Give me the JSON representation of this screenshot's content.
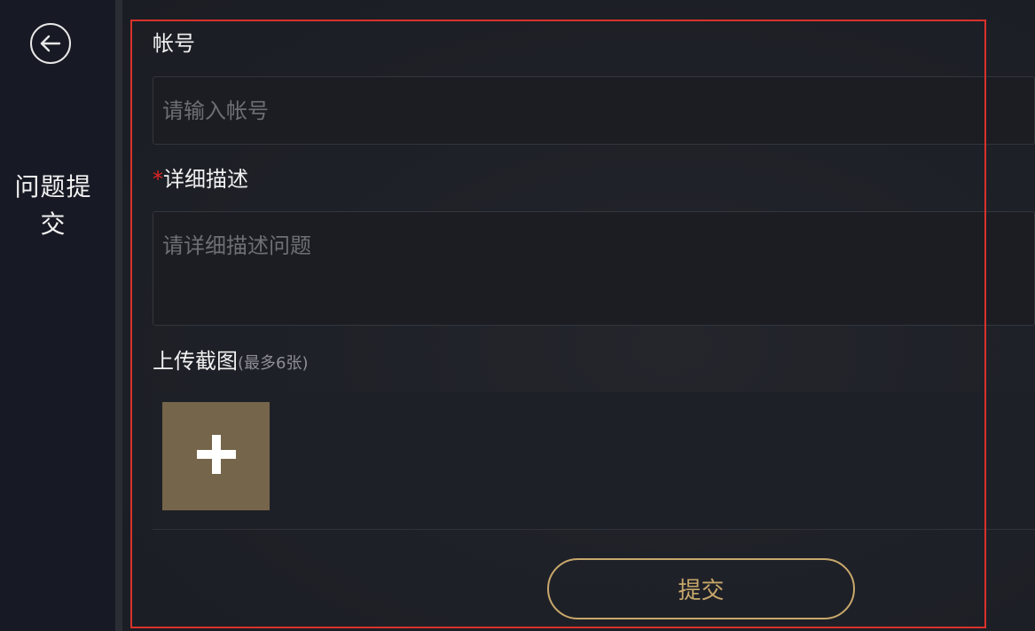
{
  "sidebar": {
    "title_line1": "问题提",
    "title_line2": "交",
    "back_icon": "arrow-left-circle-icon"
  },
  "form": {
    "account": {
      "label": "帐号",
      "placeholder": "请输入帐号",
      "value": ""
    },
    "description": {
      "required_mark": "*",
      "label": "详细描述",
      "placeholder": "请详细描述问题",
      "value": ""
    },
    "upload": {
      "label": "上传截图",
      "hint": "(最多6张)",
      "add_icon": "plus-icon"
    },
    "submit_label": "提交"
  },
  "colors": {
    "accent_gold": "#c8a86b",
    "upload_tile": "#75654a",
    "required_red": "#e02424",
    "highlight_frame": "#d9322b"
  }
}
